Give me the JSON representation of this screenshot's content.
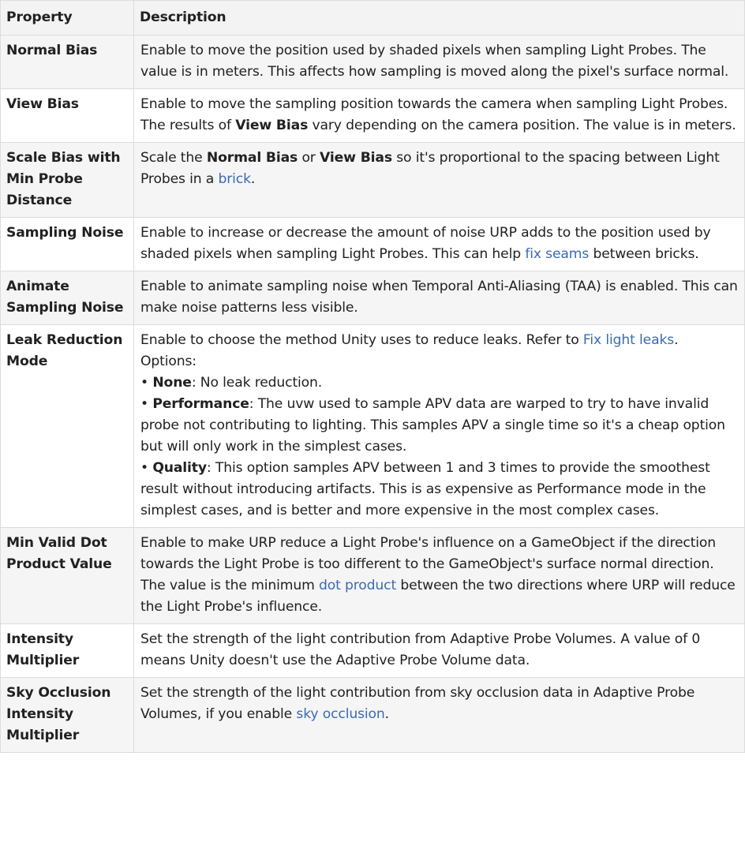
{
  "header": {
    "property": "Property",
    "description": "Description"
  },
  "rows": [
    {
      "name": "Normal Bias",
      "desc": [
        {
          "t": "Enable to move the position used by shaded pixels when sampling Light Probes. The value is in meters. This affects how sampling is moved along the pixel's surface normal."
        }
      ]
    },
    {
      "name": "View Bias",
      "desc": [
        {
          "t": "Enable to move the sampling position towards the camera when sampling Light Probes. The results of "
        },
        {
          "t": "View Bias",
          "b": true
        },
        {
          "t": " vary depending on the camera position. The value is in meters."
        }
      ]
    },
    {
      "name": "Scale Bias with Min Probe Distance",
      "desc": [
        {
          "t": "Scale the "
        },
        {
          "t": "Normal Bias",
          "b": true
        },
        {
          "t": " or "
        },
        {
          "t": "View Bias",
          "b": true
        },
        {
          "t": " so it's proportional to the spacing between Light Probes in a "
        },
        {
          "t": "brick",
          "link": true
        },
        {
          "t": "."
        }
      ]
    },
    {
      "name": "Sampling Noise",
      "desc": [
        {
          "t": "Enable to increase or decrease the amount of noise URP adds to the position used by shaded pixels when sampling Light Probes. This can help "
        },
        {
          "t": "fix seams",
          "link": true
        },
        {
          "t": " between bricks."
        }
      ]
    },
    {
      "name": "Animate Sampling Noise",
      "desc": [
        {
          "t": "Enable to animate sampling noise when Temporal Anti-Aliasing (TAA) is enabled. This can make noise patterns less visible."
        }
      ]
    },
    {
      "name": "Leak Reduction Mode",
      "desc": [
        {
          "t": "Enable to choose the method Unity uses to reduce leaks. Refer to "
        },
        {
          "t": "Fix light leaks",
          "link": true
        },
        {
          "t": "."
        },
        {
          "br": true
        },
        {
          "t": "Options:"
        },
        {
          "br": true
        },
        {
          "t": "• "
        },
        {
          "t": "None",
          "b": true
        },
        {
          "t": ": No leak reduction."
        },
        {
          "br": true
        },
        {
          "t": "• "
        },
        {
          "t": "Performance",
          "b": true
        },
        {
          "t": ": The uvw used to sample APV data are warped to try to have invalid probe not contributing to lighting. This samples APV a single time so it's a cheap option but will only work in the simplest cases."
        },
        {
          "br": true
        },
        {
          "t": "• "
        },
        {
          "t": "Quality",
          "b": true
        },
        {
          "t": ": This option samples APV between 1 and 3 times to provide the smoothest result without introducing artifacts. This is as expensive as Performance mode in the simplest cases, and is better and more expensive in the most complex cases."
        }
      ]
    },
    {
      "name": "Min Valid Dot Product Value",
      "desc": [
        {
          "t": "Enable to make URP reduce a Light Probe's influence on a GameObject if the direction towards the Light Probe is too different to the GameObject's surface normal direction. The value is the minimum "
        },
        {
          "t": "dot product",
          "link": true
        },
        {
          "t": " between the two directions where URP will reduce the Light Probe's influence."
        }
      ]
    },
    {
      "name": "Intensity Multiplier",
      "desc": [
        {
          "t": "Set the strength of the light contribution from Adaptive Probe Volumes. A value of 0 means Unity doesn't use the Adaptive Probe Volume data."
        }
      ]
    },
    {
      "name": "Sky Occlusion Intensity Multiplier",
      "desc": [
        {
          "t": "Set the strength of the light contribution from sky occlusion data in Adaptive Probe Volumes, if you enable "
        },
        {
          "t": "sky occlusion",
          "link": true
        },
        {
          "t": "."
        }
      ]
    }
  ]
}
